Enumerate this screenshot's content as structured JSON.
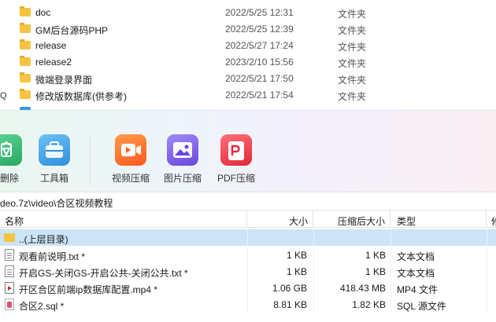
{
  "background_window": {
    "rows": [
      {
        "name": "doc",
        "date": "2022/5/25 12:31",
        "type": "文件夹"
      },
      {
        "name": "GM后台源码PHP",
        "date": "2022/5/25 12:39",
        "type": "文件夹"
      },
      {
        "name": "release",
        "date": "2022/5/27 17:24",
        "type": "文件夹"
      },
      {
        "name": "release2",
        "date": "2023/2/10 15:56",
        "type": "文件夹"
      },
      {
        "name": "微端登录界面",
        "date": "2022/5/21 17:50",
        "type": "文件夹"
      },
      {
        "name": "修改版数据库(供参考)",
        "date": "2022/5/21 17:54",
        "type": "文件夹"
      }
    ],
    "edge_mark": "Q"
  },
  "toolbar": {
    "items": [
      {
        "label": "删除",
        "icon": "recycle-icon",
        "color": "#3dbb74"
      },
      {
        "label": "工具箱",
        "icon": "toolbox-icon",
        "color": "#3fa0e6"
      },
      {
        "label": "视频压缩",
        "icon": "video-icon",
        "color": "#ff6b2c"
      },
      {
        "label": "图片压缩",
        "icon": "image-icon",
        "color": "#7c5ce8"
      },
      {
        "label": "PDF压缩",
        "icon": "pdf-icon",
        "color": "#ef3e4a"
      }
    ]
  },
  "address": {
    "path": "deo.7z\\video\\合区视频教程"
  },
  "columns": {
    "name": "名称",
    "size": "大小",
    "packed": "压缩后大小",
    "type": "类型",
    "extra": "修"
  },
  "files": [
    {
      "name": "..(上层目录)",
      "size": "",
      "packed": "",
      "type": "",
      "icon": "folder-up-icon",
      "selected": true
    },
    {
      "name": "观看前说明.txt *",
      "size": "1 KB",
      "packed": "1 KB",
      "type": "文本文档",
      "icon": "txt-file-icon"
    },
    {
      "name": "开启GS-关闭GS-开启公共-关闭公共.txt *",
      "size": "1 KB",
      "packed": "1 KB",
      "type": "文本文档",
      "icon": "txt-file-icon"
    },
    {
      "name": "开区合区前端ip数据库配置.mp4 *",
      "size": "1.06 GB",
      "packed": "418.43 MB",
      "type": "MP4 文件",
      "icon": "mp4-file-icon"
    },
    {
      "name": "合区2.sql *",
      "size": "8.81 KB",
      "packed": "1.82 KB",
      "type": "SQL 源文件",
      "icon": "sql-file-icon"
    }
  ],
  "colors": {
    "selection": "#cce4f7",
    "folder": "#f6c343"
  }
}
